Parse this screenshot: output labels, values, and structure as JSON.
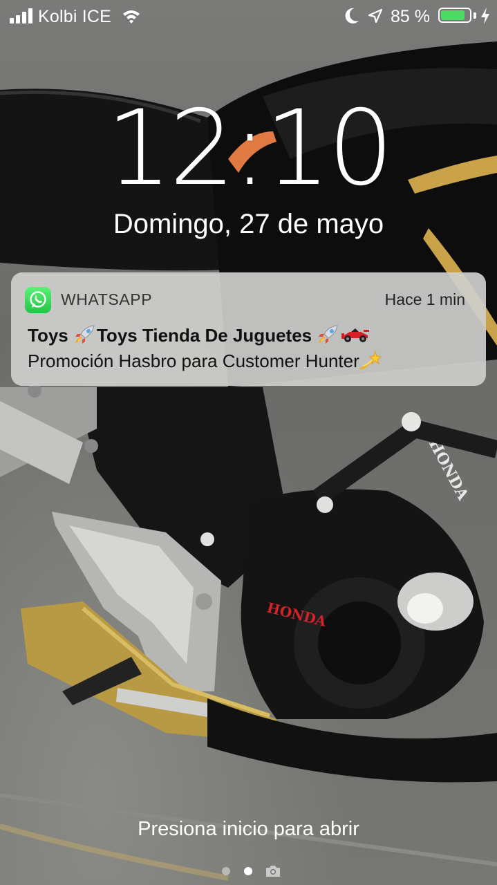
{
  "status_bar": {
    "carrier": "Kolbi ICE",
    "battery_percent": "85 %",
    "battery_level": 0.85,
    "battery_color": "#4cd964",
    "icons": [
      "signal-icon",
      "wifi-icon",
      "moon-icon",
      "location-icon",
      "battery-icon",
      "charging-bolt-icon"
    ]
  },
  "lock_screen": {
    "time": "12:10",
    "date": "Domingo, 27 de mayo",
    "unlock_hint": "Presiona inicio para abrir",
    "page_indicator": {
      "pages": 2,
      "current": 2,
      "trailing_icon": "camera-icon"
    }
  },
  "notification": {
    "app_name": "WHATSAPP",
    "app_icon": "whatsapp-icon",
    "app_color": "#25d366",
    "time": "Hace 1 min",
    "title_part1": "Toys ",
    "title_part2": "Toys Tienda De Juguetes ",
    "title_emojis": [
      "rocket-icon",
      "rocket-icon",
      "racing-car-icon"
    ],
    "body": "Promoción Hasbro para Customer Hunter",
    "body_emoji": "dizzy-icon"
  }
}
